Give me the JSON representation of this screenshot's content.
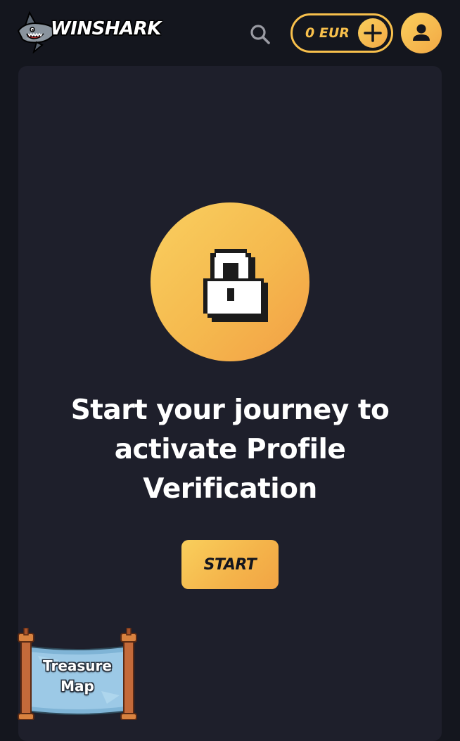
{
  "header": {
    "logo_text": "WINSHARK",
    "balance": "0 EUR",
    "icons": {
      "logo": "shark-mascot-icon",
      "search": "search-icon",
      "deposit": "plus-icon",
      "profile": "user-icon"
    }
  },
  "main": {
    "lock_icon": "padlock-icon",
    "headline": "Start your journey to activate Profile Verification",
    "start_label": "START"
  },
  "widget": {
    "label": "Treasure Map",
    "icon": "treasure-map-scroll-icon"
  },
  "colors": {
    "background": "#14161e",
    "card": "#1e1f2b",
    "accent": "#f8c04c",
    "accent_dark": "#f29f45"
  }
}
